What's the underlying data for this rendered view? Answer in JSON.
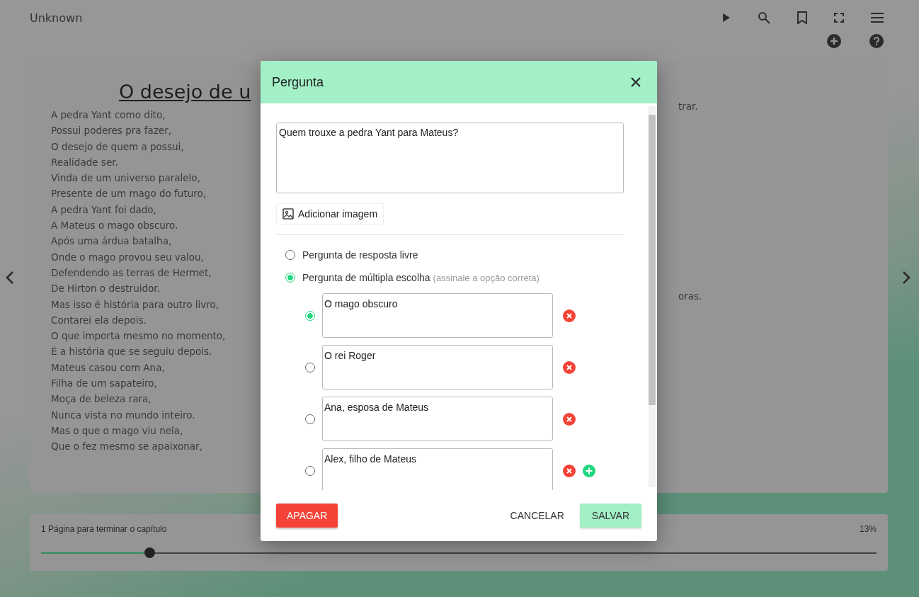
{
  "header": {
    "title": "Unknown"
  },
  "book": {
    "title": "O desejo de u",
    "lines": [
      "A pedra Yant como dito,",
      "Possui poderes pra fazer,",
      "O desejo de quem a possui,",
      "Realidade ser.",
      "Vinda de um universo paralelo,",
      "Presente de um mago do futuro,",
      "A pedra Yant foi dado,",
      "A Mateus o mago obscuro.",
      "Após uma árdua batalha,",
      "Onde o mago provou seu valou,",
      "Defendendo as terras de Hermet,",
      "De Hirton o destruidor.",
      "Mas isso é história para outro livro,",
      "Contarei ela depois.",
      "O que importa mesmo no momento,",
      "É a história que se seguiu depois.",
      "Mateus casou com Ana,",
      "Filha de um sapateiro,",
      "Moça de beleza rara,",
      "Nunca vista no mundo inteiro.",
      "Mas o que o mago viu nela,",
      "Que o fez mesmo se apaixonar,"
    ],
    "fragments": [
      "trar.",
      "oras."
    ]
  },
  "progress": {
    "label": "1 Página para terminar o capítulo",
    "percent": "13%",
    "level": 0.13
  },
  "dialog": {
    "title": "Pergunta",
    "question": "Quem trouxe a pedra Yant para Mateus?",
    "add_image": "Adicionar imagem",
    "types": [
      {
        "label": "Pergunta de resposta livre",
        "selected": false
      },
      {
        "label": "Pergunta de múltipla escolha",
        "hint": "(assinale a opção correta)",
        "selected": true
      }
    ],
    "options": [
      {
        "text": "O mago obscuro",
        "selected": true,
        "addable": false
      },
      {
        "text": "O rei Roger",
        "selected": false,
        "addable": false
      },
      {
        "text": "Ana, esposa de Mateus",
        "selected": false,
        "addable": false
      },
      {
        "text": "Alex, filho de Mateus",
        "selected": false,
        "addable": true
      }
    ],
    "buttons": {
      "delete": "APAGAR",
      "cancel": "CANCELAR",
      "save": "SALVAR"
    }
  }
}
